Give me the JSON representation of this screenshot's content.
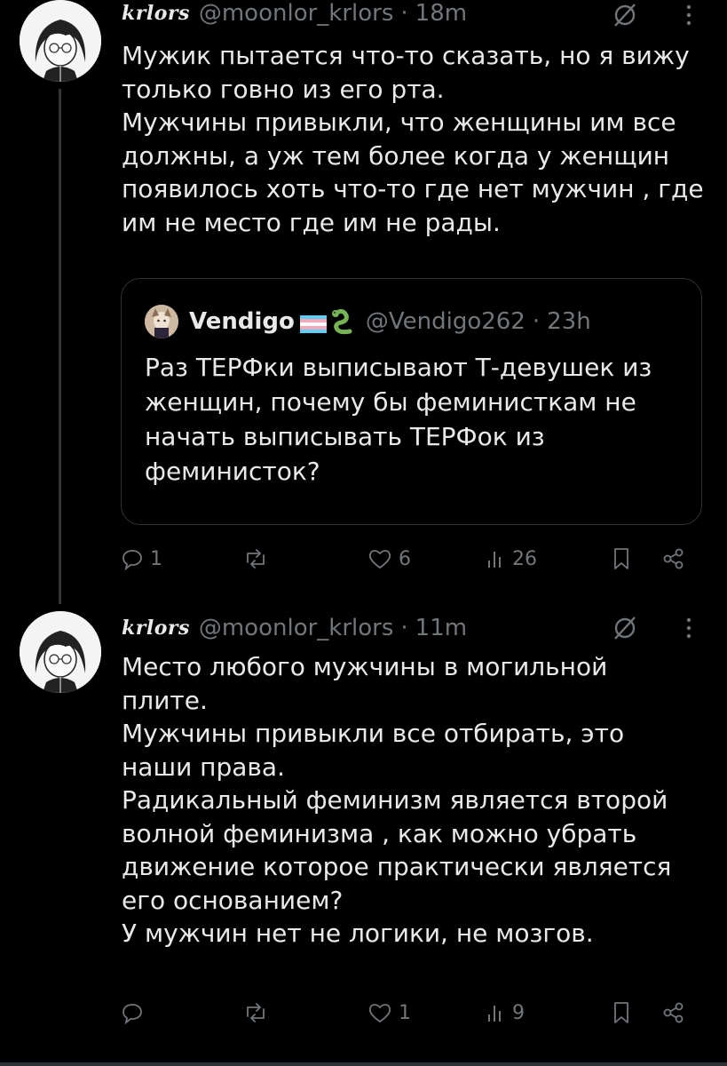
{
  "tweets": [
    {
      "name": "krlors",
      "handle": "@moonlor_krlors",
      "sep": "·",
      "time": "18m",
      "lines": [
        "Мужик пытается что-то сказать, но я вижу",
        "только говно из его рта.",
        "Мужчины привыкли, что женщины им все",
        "должны, а уж тем более когда у женщин",
        "появилось хоть что-то где нет мужчин , где",
        "им не место где им не рады."
      ],
      "actions": {
        "replies": "1",
        "reposts": "",
        "likes": "6",
        "views": "26"
      }
    },
    {
      "name": "krlors",
      "handle": "@moonlor_krlors",
      "sep": "·",
      "time": "11m",
      "lines": [
        "Место любого мужчины в могильной",
        "плите.",
        "Мужчины привыкли все отбирать, это",
        "наши права.",
        "Радикальный феминизм является второй",
        "волной феминизма , как можно убрать",
        "движение которое практически является",
        "его основанием?",
        "У мужчин нет не логики, не мозгов."
      ],
      "actions": {
        "replies": "",
        "reposts": "",
        "likes": "1",
        "views": "9"
      }
    }
  ],
  "quote": {
    "name": "Vendigo",
    "flag_emoji": "🏳️‍⚧️",
    "snake_emoji": "🐍",
    "handle": "@Vendigo262",
    "sep": "·",
    "time": "23h",
    "lines": [
      "Раз ТЕРФки выписывают Т-девушек из",
      "женщин, почему бы феминисткам не",
      "начать выписывать ТЕРФок из",
      "феминисток?"
    ]
  },
  "colors": {
    "background": "#000000",
    "text": "#e7e9ea",
    "muted": "#71767b",
    "border": "#2f3336",
    "trans_blue": "#5bcefa",
    "trans_pink": "#f5a9b8",
    "snake_green": "#77b255"
  },
  "icons": [
    "slash-circle-icon",
    "more-icon",
    "reply-icon",
    "repost-icon",
    "like-icon",
    "views-icon",
    "bookmark-icon",
    "share-icon"
  ]
}
